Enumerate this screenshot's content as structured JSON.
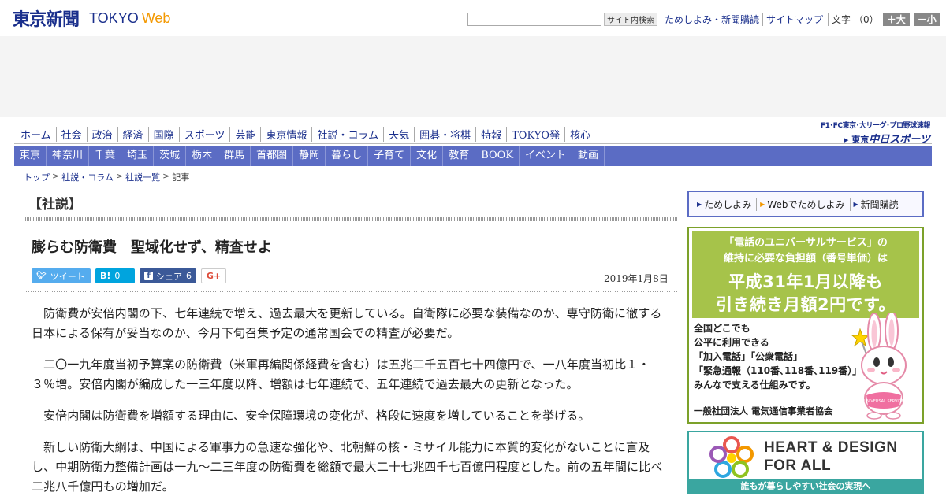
{
  "header": {
    "logo_jp": "東京新聞",
    "logo_tokyo": "TOKYO",
    "logo_web": "Web",
    "search_placeholder": "",
    "search_button": "サイト内検索",
    "links": [
      "ためしよみ・新聞購読",
      "サイトマップ"
    ],
    "font_size_label": "文字",
    "font_size_value": "（0）",
    "size_up": "＋大",
    "size_down": "－小"
  },
  "nav_primary": [
    "ホーム",
    "社会",
    "政治",
    "経済",
    "国際",
    "スポーツ",
    "芸能",
    "東京情報",
    "社説・コラム",
    "天気",
    "囲碁・将棋",
    "特報",
    "TOKYO発",
    "核心"
  ],
  "partner": {
    "top": "F1･FC東京･大リーグ･プロ野球速報",
    "bottom_prefix": "東京",
    "bottom_brand": "中日スポーツ"
  },
  "nav_secondary": [
    "東京",
    "神奈川",
    "千葉",
    "埼玉",
    "茨城",
    "栃木",
    "群馬",
    "首都圏",
    "静岡",
    "暮らし",
    "子育て",
    "文化",
    "教育",
    "BOOK",
    "イベント",
    "動画"
  ],
  "breadcrumb": [
    "トップ",
    "社説・コラム",
    "社説一覧",
    "記事"
  ],
  "article": {
    "section": "【社説】",
    "headline": "膨らむ防衛費　聖域化せず、精査せよ",
    "date": "2019年1月8日",
    "social": {
      "tweet_label": "ツイート",
      "hatena_icon": "B!",
      "hatena_count": "0",
      "facebook_label": "シェア",
      "facebook_count": "6",
      "gplus_label": "G+"
    },
    "paragraphs": [
      "防衛費が安倍内閣の下、七年連続で増え、過去最大を更新している。自衛隊に必要な装備なのか、専守防衛に徹する日本による保有が妥当なのか、今月下旬召集予定の通常国会での精査が必要だ。",
      "二〇一九年度当初予算案の防衛費（米軍再編関係経費を含む）は五兆二千五百七十四億円で、一八年度当初比１・３％増。安倍内閣が編成した一三年度以降、増額は七年連続で、五年連続で過去最大の更新となった。",
      "安倍内閣は防衛費を増額する理由に、安全保障環境の変化が、格段に速度を増していることを挙げる。",
      "新しい防衛大綱は、中国による軍事力の急速な強化や、北朝鮮の核・ミサイル能力に本質的変化がないことに言及し、中期防衛力整備計画は一九～二三年度の防衛費を総額で最大二十七兆四千七百億円程度とした。前の五年間に比べ二兆八千億円もの増加だ。"
    ]
  },
  "sidebar": {
    "links": [
      "ためしよみ",
      "Webでためしよみ",
      "新聞購読"
    ],
    "ad1": {
      "line1": "「電話のユニバーサルサービス」の",
      "line2": "維持に必要な負担額（番号単価）は",
      "line3": "平成31年1月以降も",
      "line4": "引き続き月額2円です。",
      "body": [
        "全国どこでも",
        "公平に利用できる",
        "「加入電話」「公衆電話」",
        "「緊急通報（110番､118番､119番）」を",
        "みんなで支える仕組みです。"
      ],
      "footer": "一般社団法人 電気通信事業者協会",
      "mascot_text": "UNIVERSAL SERVICE"
    },
    "ad2": {
      "title1": "HEART & DESIGN",
      "title2": "FOR ALL",
      "footer": "誰もが暮らしやすい社会の実現へ"
    }
  },
  "colors": {
    "brand_blue": "#1a2f8c",
    "web_orange": "#f39800",
    "nav_bar": "#5b6cc4",
    "ad_green": "#a6c34a",
    "ad_teal": "#3aa6a0"
  }
}
